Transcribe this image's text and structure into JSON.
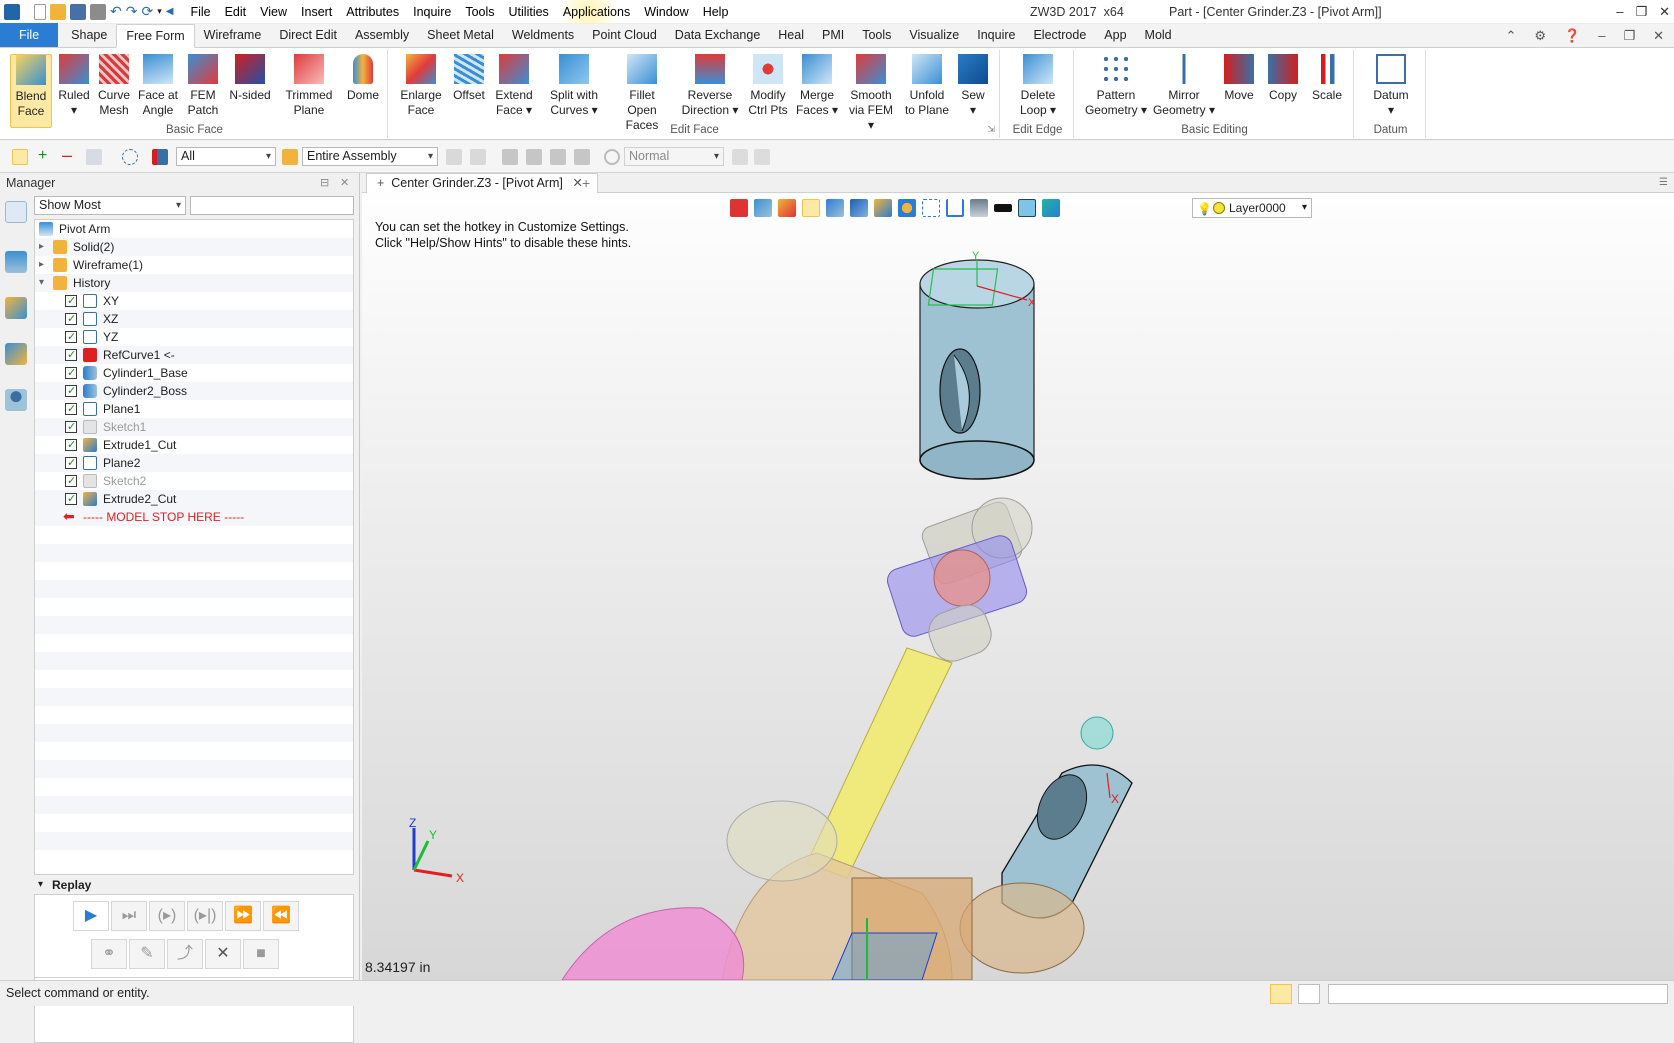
{
  "app": {
    "name": "ZW3D 2017",
    "arch": "x64",
    "doc_title": "Part - [Center Grinder.Z3 - [Pivot Arm]]"
  },
  "menu": [
    "File",
    "Edit",
    "View",
    "Insert",
    "Attributes",
    "Inquire",
    "Tools",
    "Utilities",
    "Applications",
    "Window",
    "Help"
  ],
  "ribbon_tabs": [
    "File",
    "Shape",
    "Free Form",
    "Wireframe",
    "Direct Edit",
    "Assembly",
    "Sheet Metal",
    "Weldments",
    "Point Cloud",
    "Data Exchange",
    "Heal",
    "PMI",
    "Tools",
    "Visualize",
    "Inquire",
    "Electrode",
    "App",
    "Mold"
  ],
  "active_tab": "Free Form",
  "ribbon": {
    "basic_face": {
      "label": "Basic Face",
      "buttons": [
        {
          "l1": "Blend",
          "l2": "Face"
        },
        {
          "l1": "Ruled",
          "l2": "▾"
        },
        {
          "l1": "Curve",
          "l2": "Mesh"
        },
        {
          "l1": "Face at",
          "l2": "Angle"
        },
        {
          "l1": "FEM",
          "l2": "Patch"
        },
        {
          "l1": "N-sided",
          "l2": ""
        },
        {
          "l1": "Trimmed",
          "l2": "Plane"
        },
        {
          "l1": "Dome",
          "l2": ""
        }
      ]
    },
    "edit_face": {
      "label": "Edit Face",
      "buttons": [
        {
          "l1": "Enlarge",
          "l2": "Face"
        },
        {
          "l1": "Offset",
          "l2": ""
        },
        {
          "l1": "Extend",
          "l2": "Face ▾"
        },
        {
          "l1": "Split with",
          "l2": "Curves ▾"
        },
        {
          "l1": "Fillet",
          "l2": "Open Faces"
        },
        {
          "l1": "Reverse",
          "l2": "Direction ▾"
        },
        {
          "l1": "Modify",
          "l2": "Ctrl Pts"
        },
        {
          "l1": "Merge",
          "l2": "Faces ▾"
        },
        {
          "l1": "Smooth",
          "l2": "via FEM ▾"
        },
        {
          "l1": "Unfold",
          "l2": "to Plane"
        },
        {
          "l1": "Sew",
          "l2": "▾"
        }
      ]
    },
    "edit_edge": {
      "label": "Edit Edge",
      "buttons": [
        {
          "l1": "Delete",
          "l2": "Loop ▾"
        }
      ]
    },
    "basic_editing": {
      "label": "Basic Editing",
      "buttons": [
        {
          "l1": "Pattern",
          "l2": "Geometry ▾"
        },
        {
          "l1": "Mirror",
          "l2": "Geometry ▾"
        },
        {
          "l1": "Move",
          "l2": ""
        },
        {
          "l1": "Copy",
          "l2": ""
        },
        {
          "l1": "Scale",
          "l2": ""
        }
      ]
    },
    "datum": {
      "label": "Datum",
      "buttons": [
        {
          "l1": "Datum",
          "l2": "▾"
        }
      ]
    }
  },
  "toolbar": {
    "filter_value": "All",
    "scope_value": "Entire Assembly",
    "render_mode": "Normal"
  },
  "manager": {
    "title": "Manager",
    "filter_value": "Show Most",
    "root": "Pivot Arm",
    "folders": [
      "Solid(2)",
      "Wireframe(1)",
      "History"
    ],
    "history": [
      {
        "name": "XY",
        "icon": "plane-icon",
        "dim": false
      },
      {
        "name": "XZ",
        "icon": "plane-icon",
        "dim": false
      },
      {
        "name": "YZ",
        "icon": "plane-icon",
        "dim": false
      },
      {
        "name": "RefCurve1 <-",
        "icon": "ref-icon",
        "dim": false
      },
      {
        "name": "Cylinder1_Base",
        "icon": "cylinder-icon",
        "dim": false
      },
      {
        "name": "Cylinder2_Boss",
        "icon": "cylinder-icon",
        "dim": false
      },
      {
        "name": "Plane1",
        "icon": "plane-icon",
        "dim": false
      },
      {
        "name": "Sketch1",
        "icon": "sketch-icon",
        "dim": true
      },
      {
        "name": "Extrude1_Cut",
        "icon": "extrude-icon",
        "dim": false
      },
      {
        "name": "Plane2",
        "icon": "plane-icon",
        "dim": false
      },
      {
        "name": "Sketch2",
        "icon": "sketch-icon",
        "dim": true
      },
      {
        "name": "Extrude2_Cut",
        "icon": "extrude-icon",
        "dim": false
      }
    ],
    "stop_label": "----- MODEL STOP HERE -----",
    "replay_label": "Replay"
  },
  "viewport": {
    "tab_label": "Center Grinder.Z3 - [Pivot Arm]",
    "hint_line1": "You can set the hotkey in Customize Settings.",
    "hint_line2": "Click \"Help/Show Hints\" to disable these hints.",
    "layer": "Layer0000",
    "readout": "8.34197 in",
    "axis_x": "X",
    "axis_y": "Y",
    "axis_z": "Z"
  },
  "status": {
    "text": "Select command or entity."
  },
  "colors": {
    "accent": "#2b7cd3",
    "part_blue": "#9ec2d8",
    "rod_yellow": "#f0ea7c",
    "magenta": "#e88fd6",
    "stop_red": "#e01f1f"
  }
}
